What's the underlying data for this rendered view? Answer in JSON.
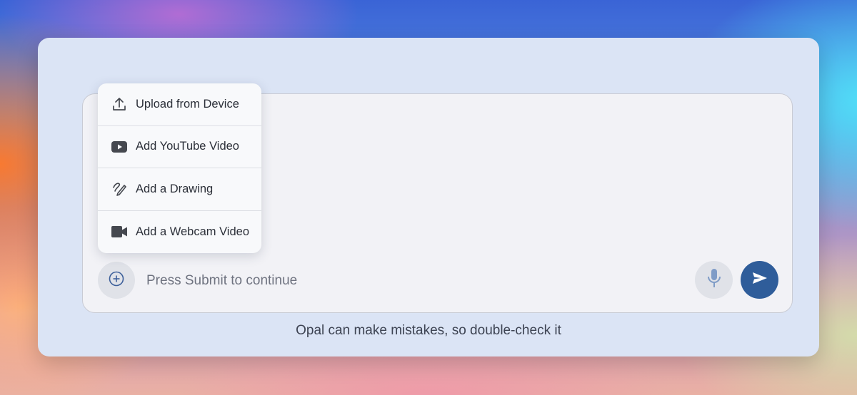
{
  "menu": {
    "items": [
      {
        "label": "Upload from Device",
        "icon": "upload-icon"
      },
      {
        "label": "Add YouTube Video",
        "icon": "youtube-icon"
      },
      {
        "label": "Add a Drawing",
        "icon": "drawing-icon"
      },
      {
        "label": "Add a Webcam Video",
        "icon": "webcam-icon"
      }
    ]
  },
  "composer": {
    "placeholder": "Press Submit to continue",
    "add_icon": "plus-circle-icon",
    "mic_icon": "microphone-icon",
    "send_icon": "send-icon"
  },
  "footer": {
    "disclaimer": "Opal can make mistakes, so double-check it"
  },
  "colors": {
    "card": "#dbe4f5",
    "send_button": "#2f5d9a",
    "input_background": "#f2f2f6"
  }
}
